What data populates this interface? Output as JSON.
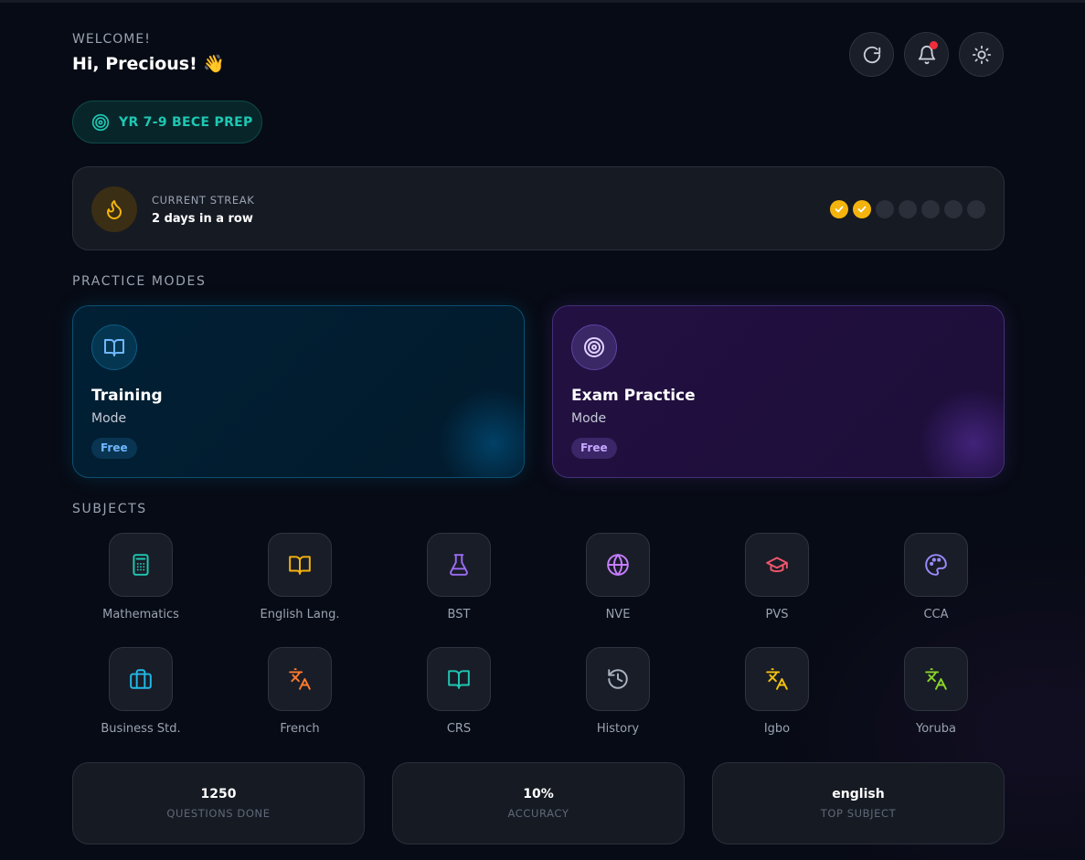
{
  "header": {
    "welcome_label": "WELCOME!",
    "greeting": "Hi, Precious! 👋",
    "actions": [
      {
        "name": "refresh-icon"
      },
      {
        "name": "bell-icon",
        "has_notification": true
      },
      {
        "name": "sun-icon"
      }
    ]
  },
  "grade_pill": {
    "label": "YR 7-9 BECE PREP",
    "icon": "target-icon",
    "color": "#1fc7b3"
  },
  "streak": {
    "label": "CURRENT STREAK",
    "value": "2 days in a row",
    "days_total": 7,
    "days_completed": 2,
    "accent": "#f4b40d"
  },
  "practice_modes": {
    "title": "PRACTICE MODES",
    "modes": [
      {
        "title": "Training",
        "subtitle": "Mode",
        "badge": "Free",
        "icon": "book-open-icon"
      },
      {
        "title": "Exam Practice",
        "subtitle": "Mode",
        "badge": "Free",
        "icon": "target-icon"
      }
    ]
  },
  "subjects": {
    "title": "SUBJECTS",
    "items": [
      {
        "label": "Mathematics",
        "icon": "calculator-icon",
        "color": "#1fc7b3"
      },
      {
        "label": "English Lang.",
        "icon": "book-open-icon",
        "color": "#f4b40d"
      },
      {
        "label": "BST",
        "icon": "flask-icon",
        "color": "#9b6cf4"
      },
      {
        "label": "NVE",
        "icon": "globe-icon",
        "color": "#c77dff"
      },
      {
        "label": "PVS",
        "icon": "graduation-cap-icon",
        "color": "#f0566d"
      },
      {
        "label": "CCA",
        "icon": "palette-icon",
        "color": "#9a8bff"
      },
      {
        "label": "Business Std.",
        "icon": "briefcase-icon",
        "color": "#22b8e6"
      },
      {
        "label": "French",
        "icon": "translate-icon",
        "color": "#ff7a2f"
      },
      {
        "label": "CRS",
        "icon": "book-open-icon",
        "color": "#1fc7b3"
      },
      {
        "label": "History",
        "icon": "history-icon",
        "color": "#aab2c0"
      },
      {
        "label": "Igbo",
        "icon": "translate-icon",
        "color": "#f4c20d"
      },
      {
        "label": "Yoruba",
        "icon": "translate-icon",
        "color": "#8ad42a"
      }
    ]
  },
  "stats": [
    {
      "value": "1250",
      "label": "QUESTIONS DONE"
    },
    {
      "value": "10%",
      "label": "ACCURACY"
    },
    {
      "value": "english",
      "label": "TOP SUBJECT"
    }
  ]
}
